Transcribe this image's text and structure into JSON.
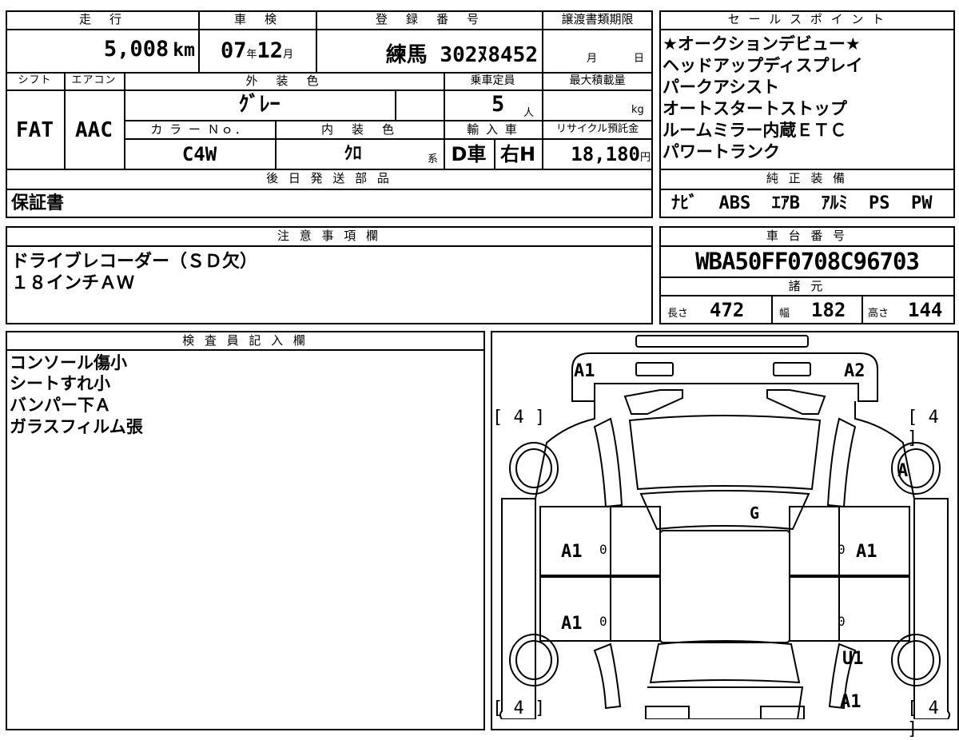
{
  "top": {
    "headers": {
      "mileage": "走　行",
      "shaken": "車　検",
      "registration": "登　録　番　号",
      "transfer_deadline": "譲渡書類期限",
      "sales_points": "セ ー ル ス ポ イ ン ト"
    },
    "mileage_value": "5,008",
    "mileage_unit": "km",
    "shaken_year": "07",
    "shaken_year_unit": "年",
    "shaken_month": "12",
    "shaken_month_unit": "月",
    "registration_value": "練馬 302ﾇ8452",
    "transfer_month": "月",
    "transfer_day": "日"
  },
  "row2": {
    "headers": {
      "shift": "シフト",
      "aircon": "エアコン",
      "exterior_color": "外　装　色",
      "capacity": "乗車定員",
      "max_load": "最大積載量"
    },
    "shift_value": "FAT",
    "aircon_value": "AAC",
    "exterior_value": "ｸﾞﾚｰ",
    "capacity_value": "5",
    "capacity_unit": "人",
    "max_load_unit": "kg"
  },
  "row3": {
    "headers": {
      "color_no": "カ ラ ー Ｎｏ．",
      "interior_color": "内　装　色",
      "import": "輸 入 車",
      "recycle": "リサイクル預託金"
    },
    "color_no_value": "C4W",
    "interior_value": "ｸﾛ",
    "interior_unit": "系",
    "import_value": "D車",
    "handle_value": "右H",
    "recycle_value": "18,180",
    "recycle_unit": "円"
  },
  "sales_points": [
    "★オークションデビュー★",
    "ヘッドアップディスプレイ",
    "パークアシスト",
    "オートスタートストップ",
    "ルームミラー内蔵ＥＴＣ",
    "パワートランク"
  ],
  "later_parts": {
    "header": "後 日 発 送 部 品",
    "value": "保証書"
  },
  "genuine_equipment": {
    "header": "純 正 装 備",
    "items": [
      "ﾅﾋﾞ",
      "ABS",
      "ｴｱB",
      "ｱﾙﾐ",
      "PS",
      "PW"
    ]
  },
  "notes": {
    "header": "注 意 事 項 欄",
    "lines": [
      "ドライブレコーダー（ＳＤ欠）",
      "１８インチＡＷ"
    ]
  },
  "chassis": {
    "header": "車 台 番 号",
    "value": "WBA50FF0708C96703"
  },
  "dimensions": {
    "header": "諸 元",
    "length_label": "長さ",
    "length_value": "472",
    "width_label": "幅",
    "width_value": "182",
    "height_label": "高さ",
    "height_value": "144"
  },
  "inspector": {
    "header": "検 査 員 記 入 欄",
    "lines": [
      "コンソール傷小",
      "シートすれ小",
      "バンパー下Ａ",
      "ガラスフィルム張"
    ]
  },
  "diagram": {
    "marks": {
      "front_left": "A1",
      "front_right": "A2",
      "windshield": "G",
      "right_front_wheel": "A",
      "left_front_door": "A1",
      "right_front_door": "A1",
      "left_rear_door": "A1",
      "right_rear_panel": "U1",
      "right_rear_lower": "A1"
    },
    "zero": "0",
    "tires": {
      "front_left": "[ 4 ]",
      "front_right": "[ 4 ]",
      "rear_left": "[ 4 ]",
      "rear_right": "[ 4 ]"
    }
  }
}
